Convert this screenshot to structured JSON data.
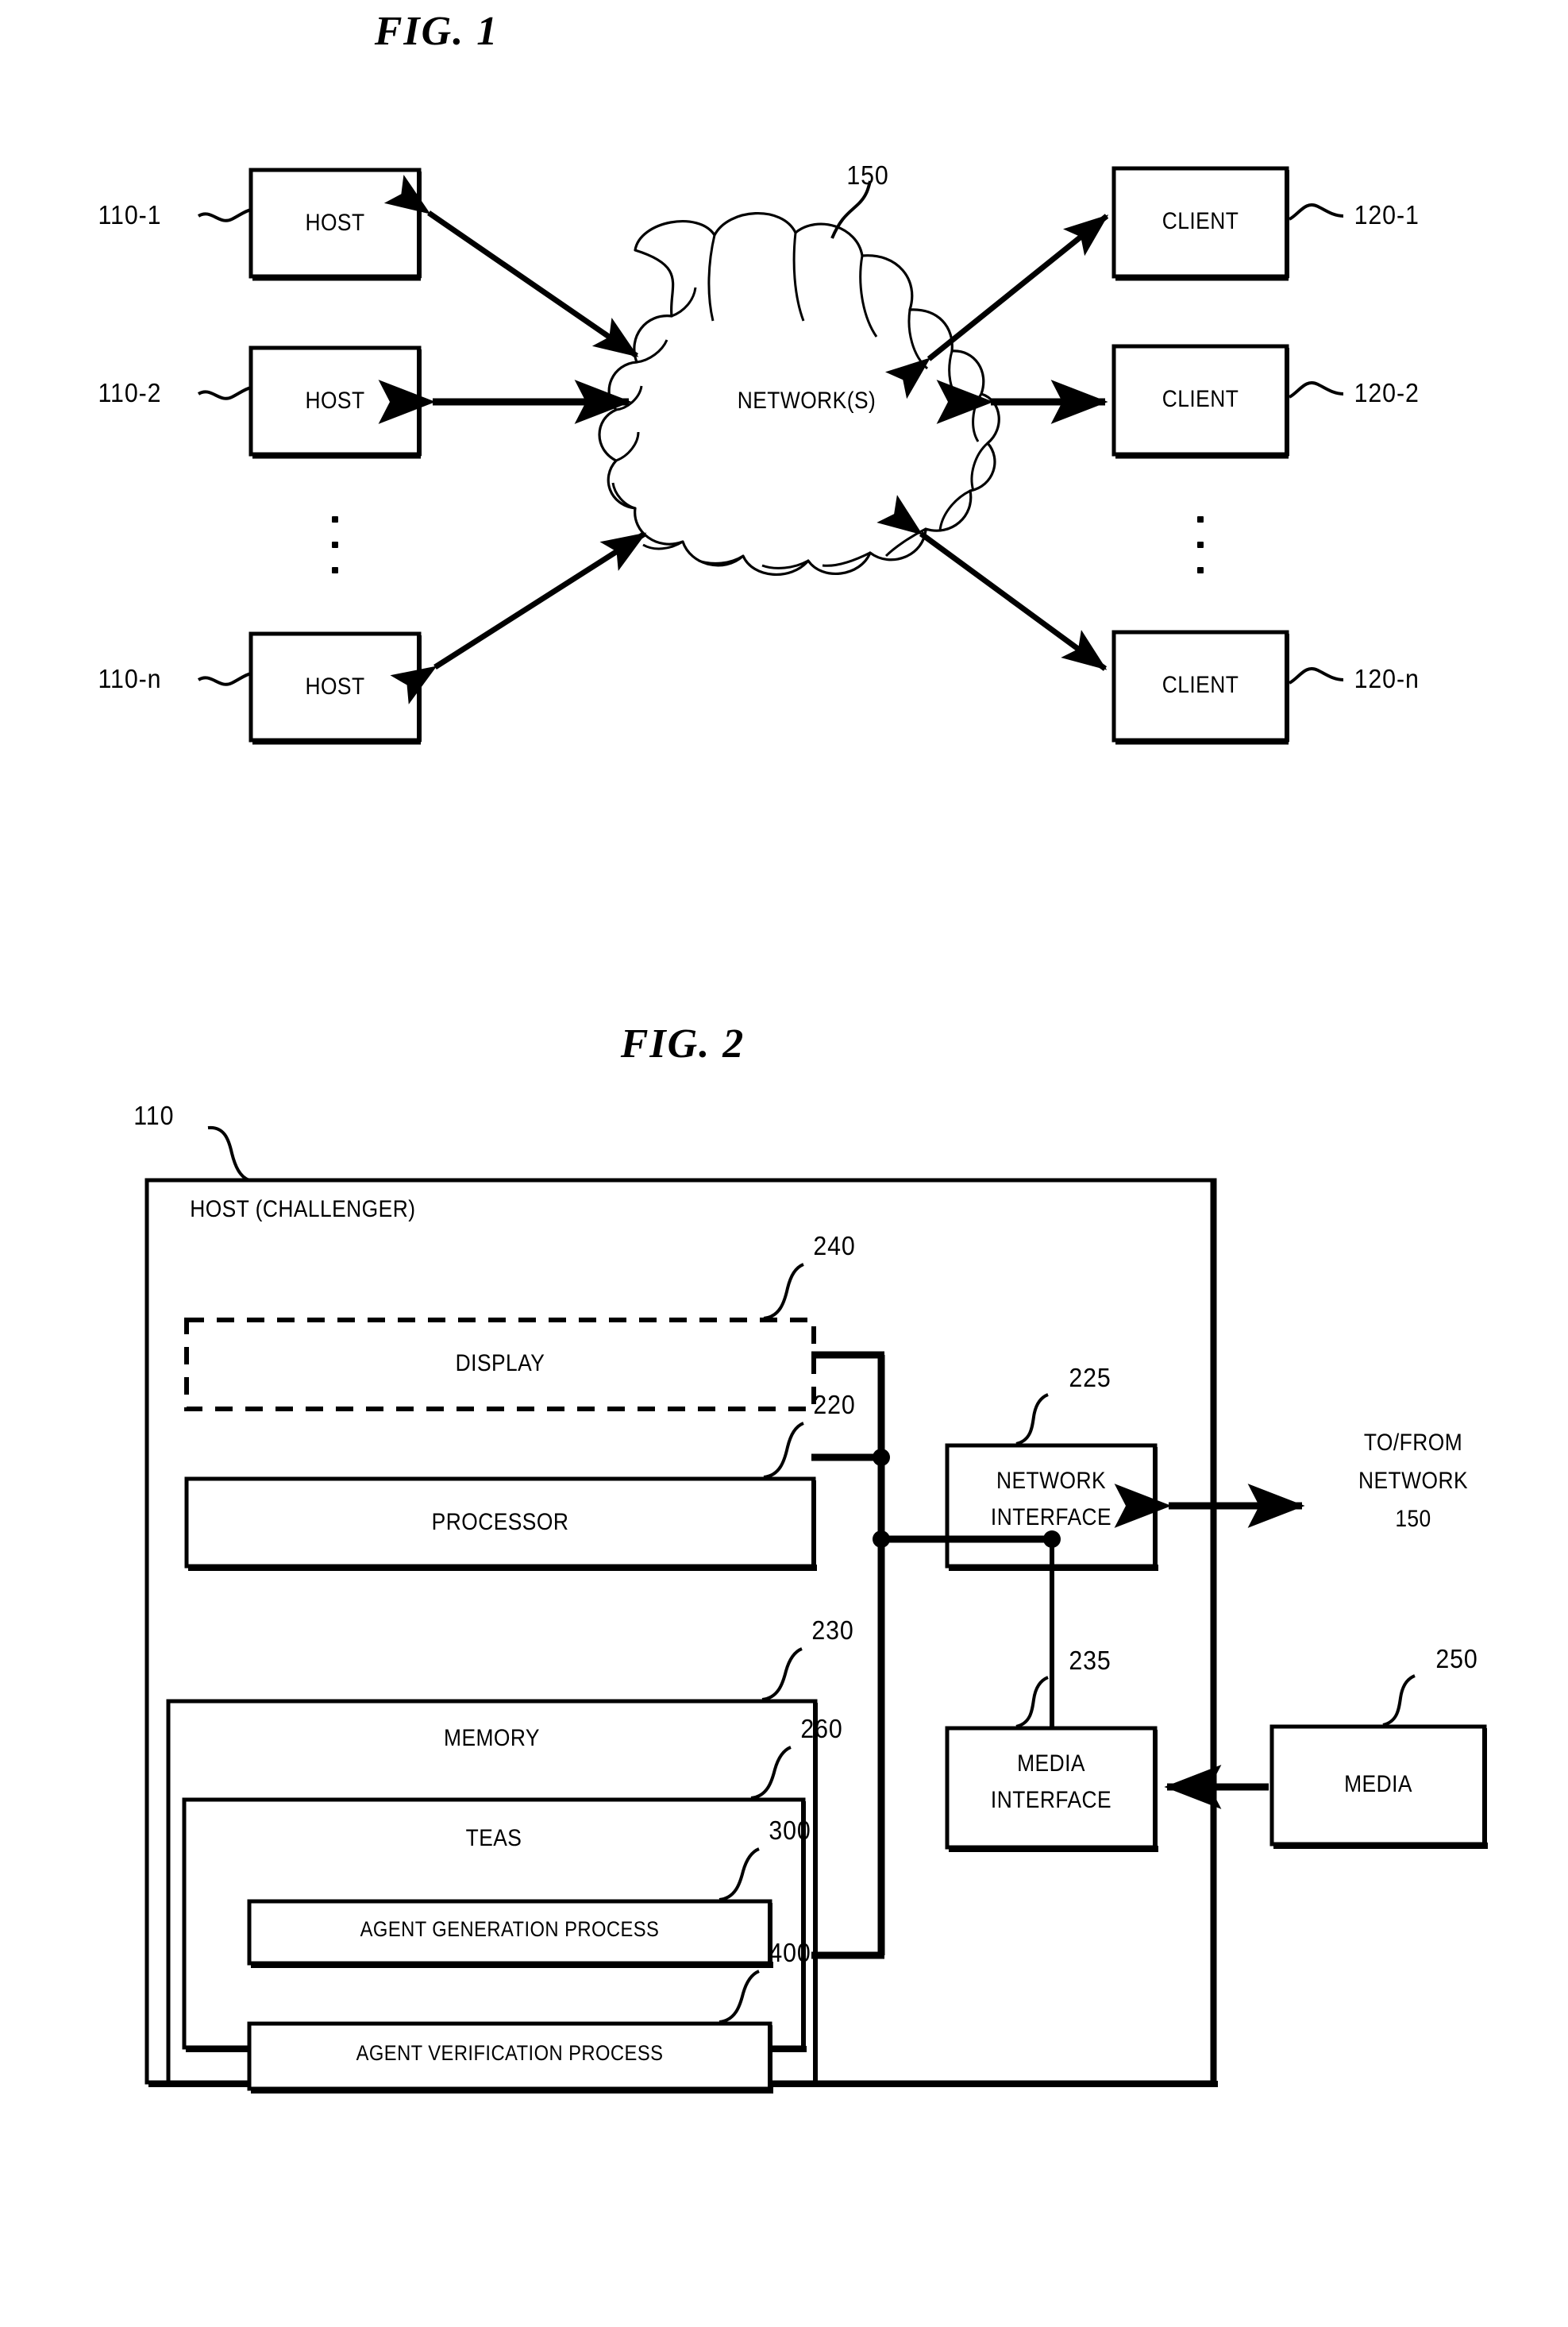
{
  "figures": {
    "fig1": {
      "title": "FIG.  1",
      "cloud_label": "NETWORK(S)",
      "cloud_ref": "150",
      "hosts": [
        {
          "label": "HOST",
          "ref": "110-1"
        },
        {
          "label": "HOST",
          "ref": "110-2"
        },
        {
          "label": "HOST",
          "ref": "110-n"
        }
      ],
      "clients": [
        {
          "label": "CLIENT",
          "ref": "120-1"
        },
        {
          "label": "CLIENT",
          "ref": "120-2"
        },
        {
          "label": "CLIENT",
          "ref": "120-n"
        }
      ],
      "ellipsis": "⋮"
    },
    "fig2": {
      "title": "FIG.  2",
      "outer_ref": "110",
      "outer_label": "HOST (CHALLENGER)",
      "blocks": {
        "display": {
          "label": "DISPLAY",
          "ref": "240"
        },
        "processor": {
          "label": "PROCESSOR",
          "ref": "220"
        },
        "memory": {
          "label": "MEMORY",
          "ref": "230"
        },
        "teas": {
          "label": "TEAS",
          "ref": "260"
        },
        "agent_generation": {
          "label": "AGENT  GENERATION  PROCESS",
          "ref": "300"
        },
        "agent_verification": {
          "label": "AGENT  VERIFICATION  PROCESS",
          "ref": "400"
        },
        "network_interface": {
          "label_line1": "NETWORK",
          "label_line2": "INTERFACE",
          "ref": "225"
        },
        "media_interface": {
          "label_line1": "MEDIA",
          "label_line2": "INTERFACE",
          "ref": "235"
        },
        "media": {
          "label": "MEDIA",
          "ref": "250"
        }
      },
      "external": {
        "network_line1": "TO/FROM",
        "network_line2": "NETWORK",
        "network_line3": "150"
      }
    }
  },
  "colors": {
    "ink": "#000000",
    "paper": "#ffffff"
  }
}
